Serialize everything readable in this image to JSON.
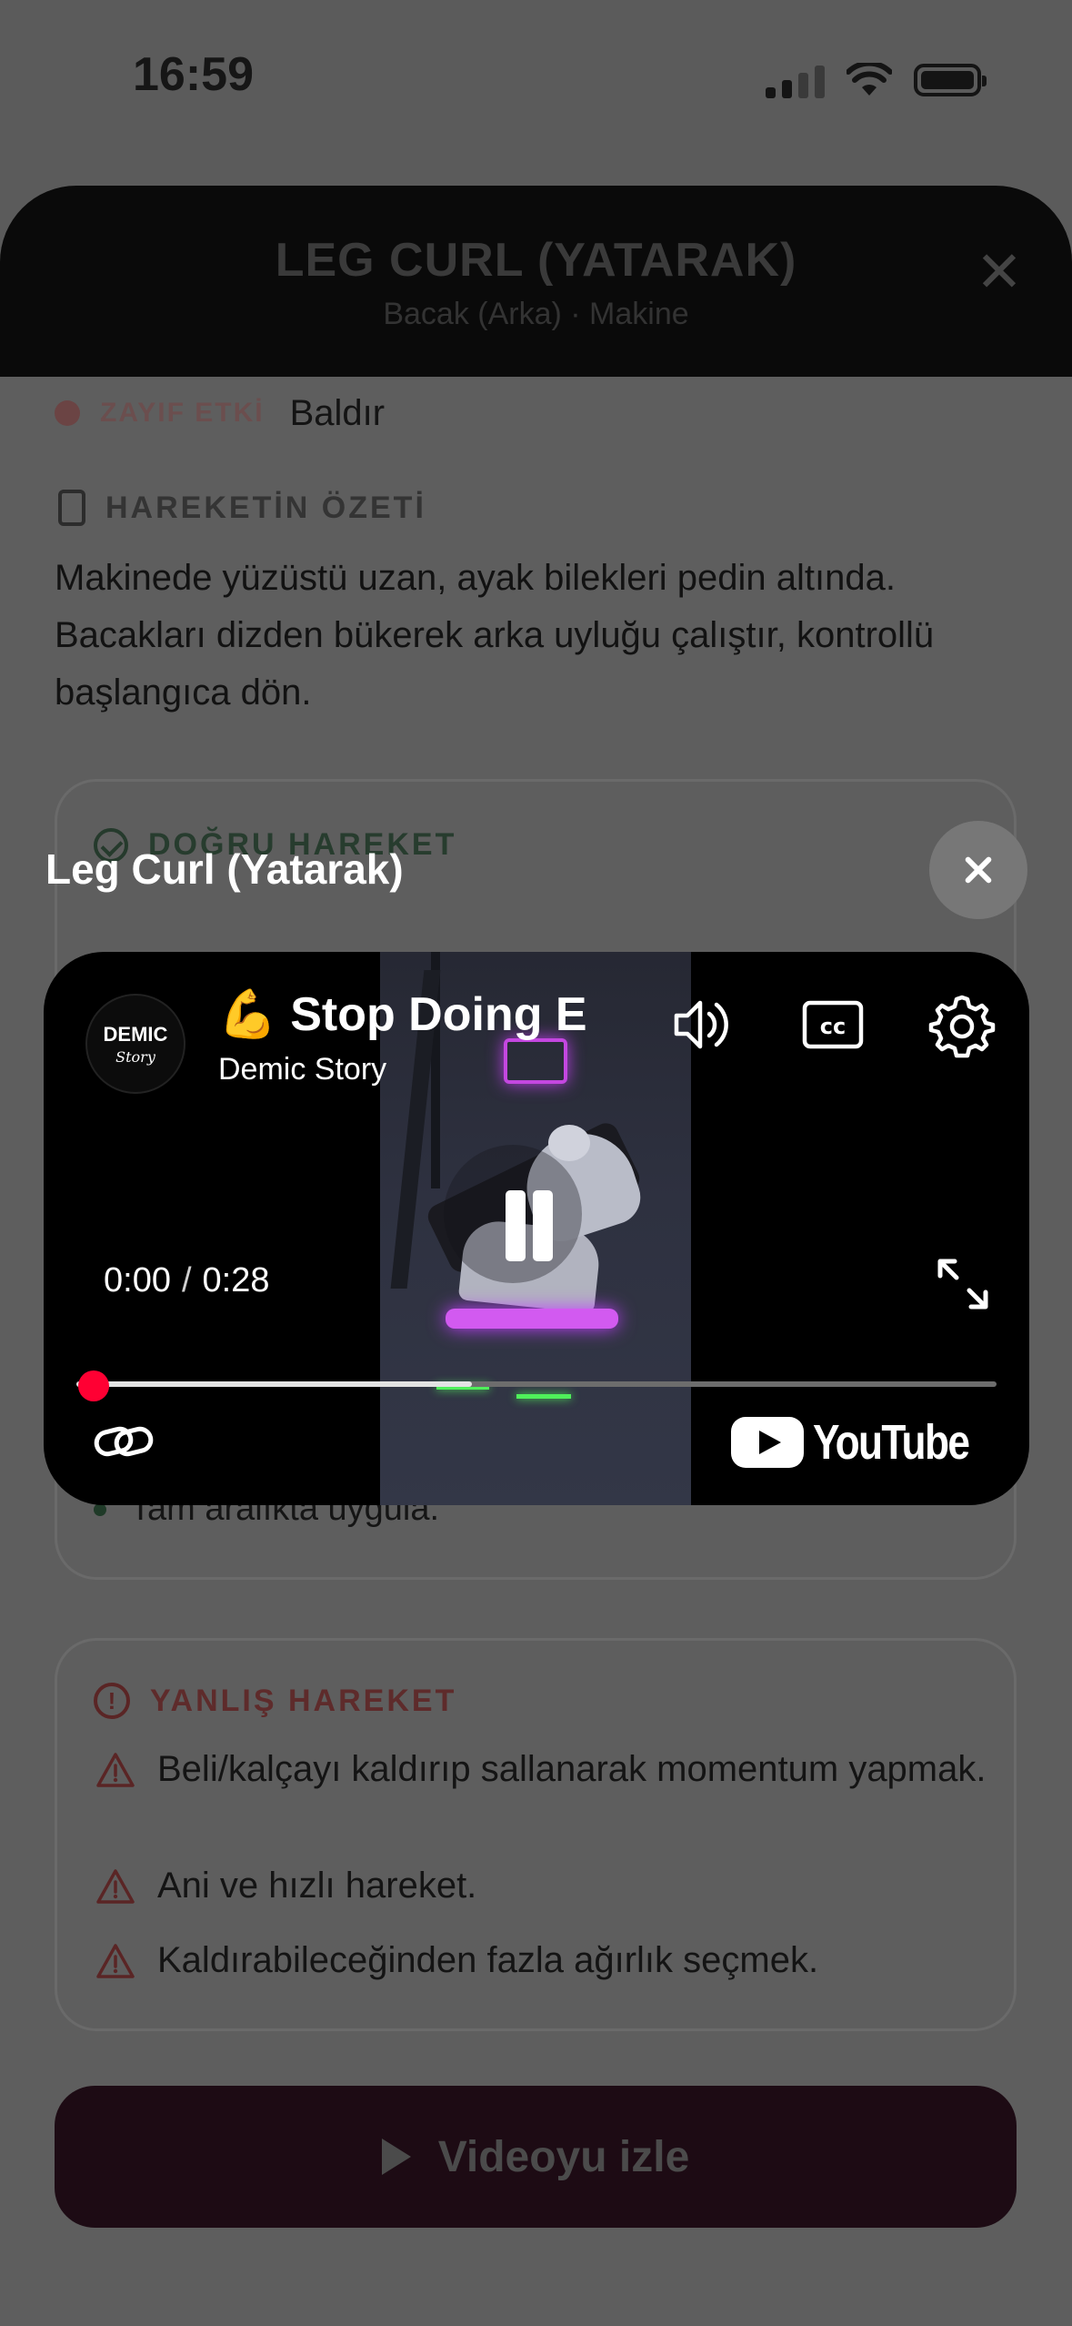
{
  "status_bar": {
    "time": "16:59"
  },
  "sheet": {
    "title": "LEG CURL (YATARAK)",
    "subtitle": "Bacak (Arka) · Makine",
    "close_glyph": "✕"
  },
  "weak_effect": {
    "label": "ZAYIF ETKİ",
    "value": "Baldır"
  },
  "summary": {
    "heading": "HAREKETİN ÖZETİ",
    "text": "Makinede yüzüstü uzan, ayak bilekleri pedin altında. Bacakları dizden bükerek arka uyluğu çalıştır, kontrollü başlangıca dön."
  },
  "correct_section": {
    "heading": "DOĞRU HAREKET",
    "visible_items": [
      "Tam aralıkta uygula."
    ]
  },
  "wrong_section": {
    "heading": "YANLIŞ HAREKET",
    "items": [
      "Beli/kalçayı kaldırıp sallanarak momentum yapmak.",
      "Ani ve hızlı hareket.",
      "Kaldırabileceğinden fazla ağırlık seçmek."
    ]
  },
  "watch_button": {
    "label": "Videoyu izle"
  },
  "video_modal": {
    "title": "Leg Curl (Yatarak)",
    "player": {
      "avatar_line1": "DEMIC",
      "avatar_line2": "Story",
      "video_title": "💪 Stop Doing E",
      "channel": "Demic Story",
      "current_time": "0:00",
      "separator": "/",
      "duration": "0:28",
      "progress_fraction": 0.0,
      "buffered_fraction": 0.43,
      "logo_text": "YouTube",
      "icons": [
        "volume-icon",
        "captions-icon",
        "settings-icon",
        "fullscreen-icon",
        "link-icon",
        "pause-icon"
      ]
    }
  },
  "colors": {
    "progress_red": "#ff0033",
    "dim_overlay": "#5e5e5e",
    "watch_button_bg": "#1d0b14"
  }
}
